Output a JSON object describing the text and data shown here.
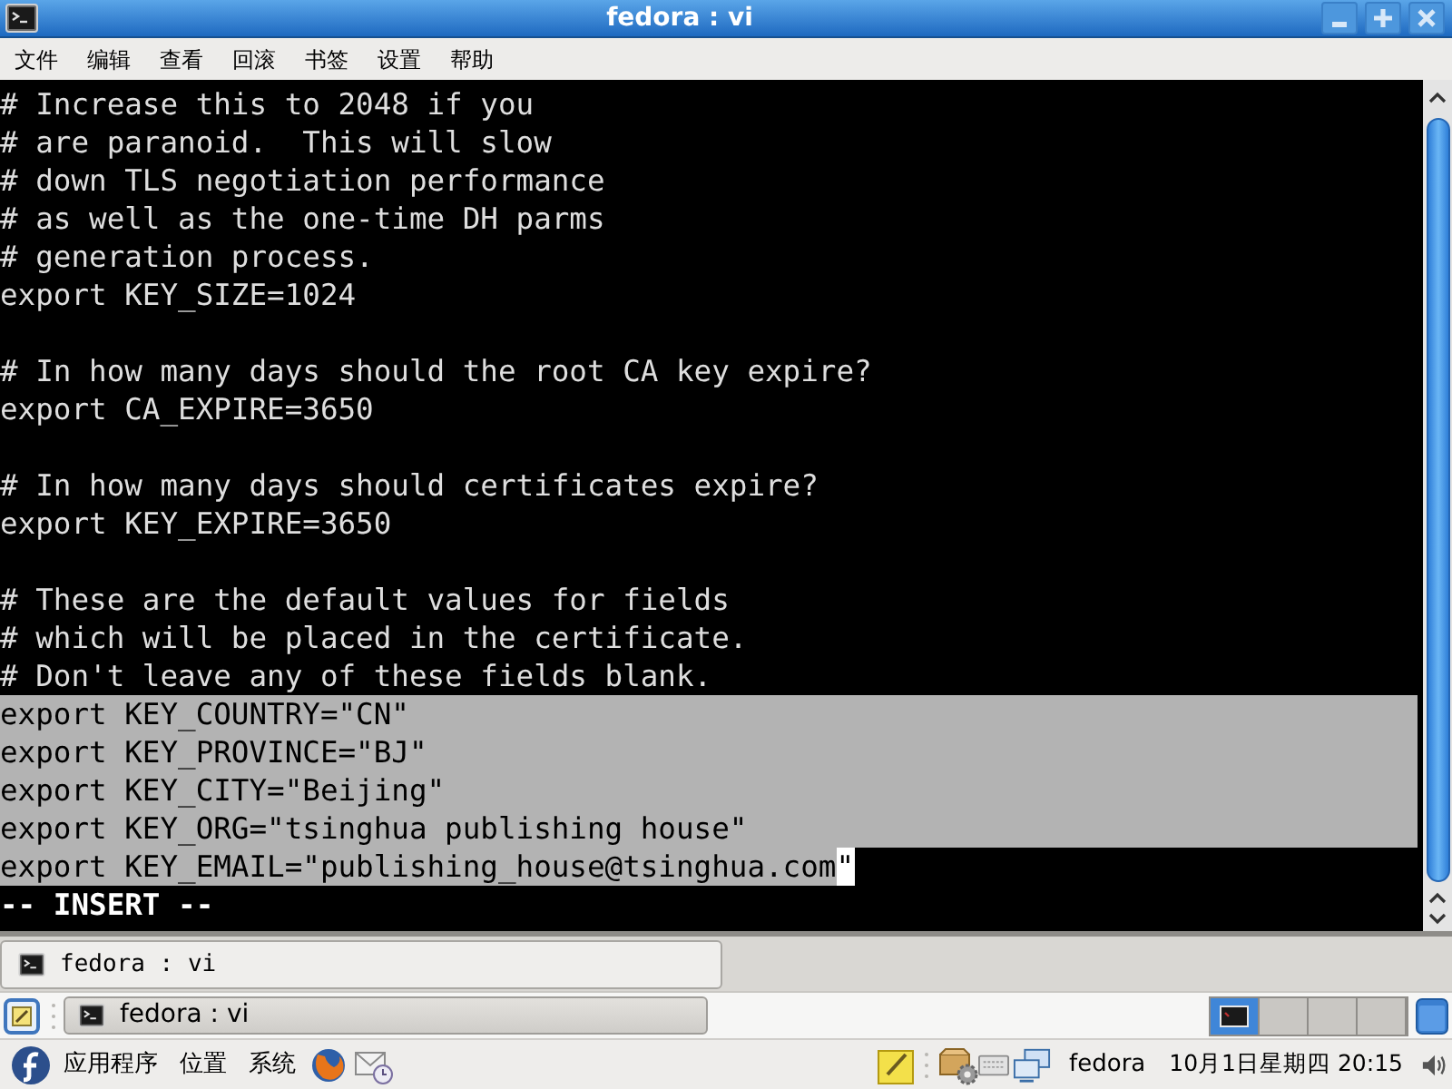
{
  "window": {
    "title": "fedora : vi"
  },
  "menu": [
    "文件",
    "编辑",
    "查看",
    "回滚",
    "书签",
    "设置",
    "帮助"
  ],
  "terminal": {
    "lines": [
      {
        "kind": "text",
        "text": "# Increase this to 2048 if you",
        "selected": false
      },
      {
        "kind": "text",
        "text": "# are paranoid.  This will slow",
        "selected": false
      },
      {
        "kind": "text",
        "text": "# down TLS negotiation performance",
        "selected": false
      },
      {
        "kind": "text",
        "text": "# as well as the one-time DH parms",
        "selected": false
      },
      {
        "kind": "text",
        "text": "# generation process.",
        "selected": false
      },
      {
        "kind": "text",
        "text": "export KEY_SIZE=1024",
        "selected": false
      },
      {
        "kind": "blank",
        "selected": false
      },
      {
        "kind": "text",
        "text": "# In how many days should the root CA key expire?",
        "selected": false
      },
      {
        "kind": "text",
        "text": "export CA_EXPIRE=3650",
        "selected": false
      },
      {
        "kind": "blank",
        "selected": false
      },
      {
        "kind": "text",
        "text": "# In how many days should certificates expire?",
        "selected": false
      },
      {
        "kind": "text",
        "text": "export KEY_EXPIRE=3650",
        "selected": false
      },
      {
        "kind": "blank",
        "selected": false
      },
      {
        "kind": "text",
        "text": "# These are the default values for fields",
        "selected": false
      },
      {
        "kind": "text",
        "text": "# which will be placed in the certificate.",
        "selected": false
      },
      {
        "kind": "text",
        "text": "# Don't leave any of these fields blank.",
        "selected": false
      },
      {
        "kind": "text",
        "text": "export KEY_COUNTRY=\"CN\"",
        "selected": true
      },
      {
        "kind": "text",
        "text": "export KEY_PROVINCE=\"BJ\"",
        "selected": true
      },
      {
        "kind": "text",
        "text": "export KEY_CITY=\"Beijing\"",
        "selected": true
      },
      {
        "kind": "text",
        "text": "export KEY_ORG=\"tsinghua publishing house\"",
        "selected": true
      },
      {
        "kind": "text",
        "text": "export KEY_EMAIL=\"publishing_house@tsinghua.com",
        "cursor": "\"",
        "selected": true
      }
    ],
    "status": "-- INSERT --"
  },
  "tabs": [
    {
      "label": "fedora : vi",
      "selected": true
    }
  ],
  "taskbar": {
    "windows": [
      {
        "label": "fedora : vi"
      }
    ],
    "workspaces": [
      {
        "selected": true
      },
      {
        "selected": false
      },
      {
        "selected": false
      },
      {
        "selected": false
      }
    ]
  },
  "panel": {
    "menus": [
      "应用程序",
      "位置",
      "系统"
    ],
    "user": "fedora",
    "clock": "10月1日星期四 20:15"
  }
}
